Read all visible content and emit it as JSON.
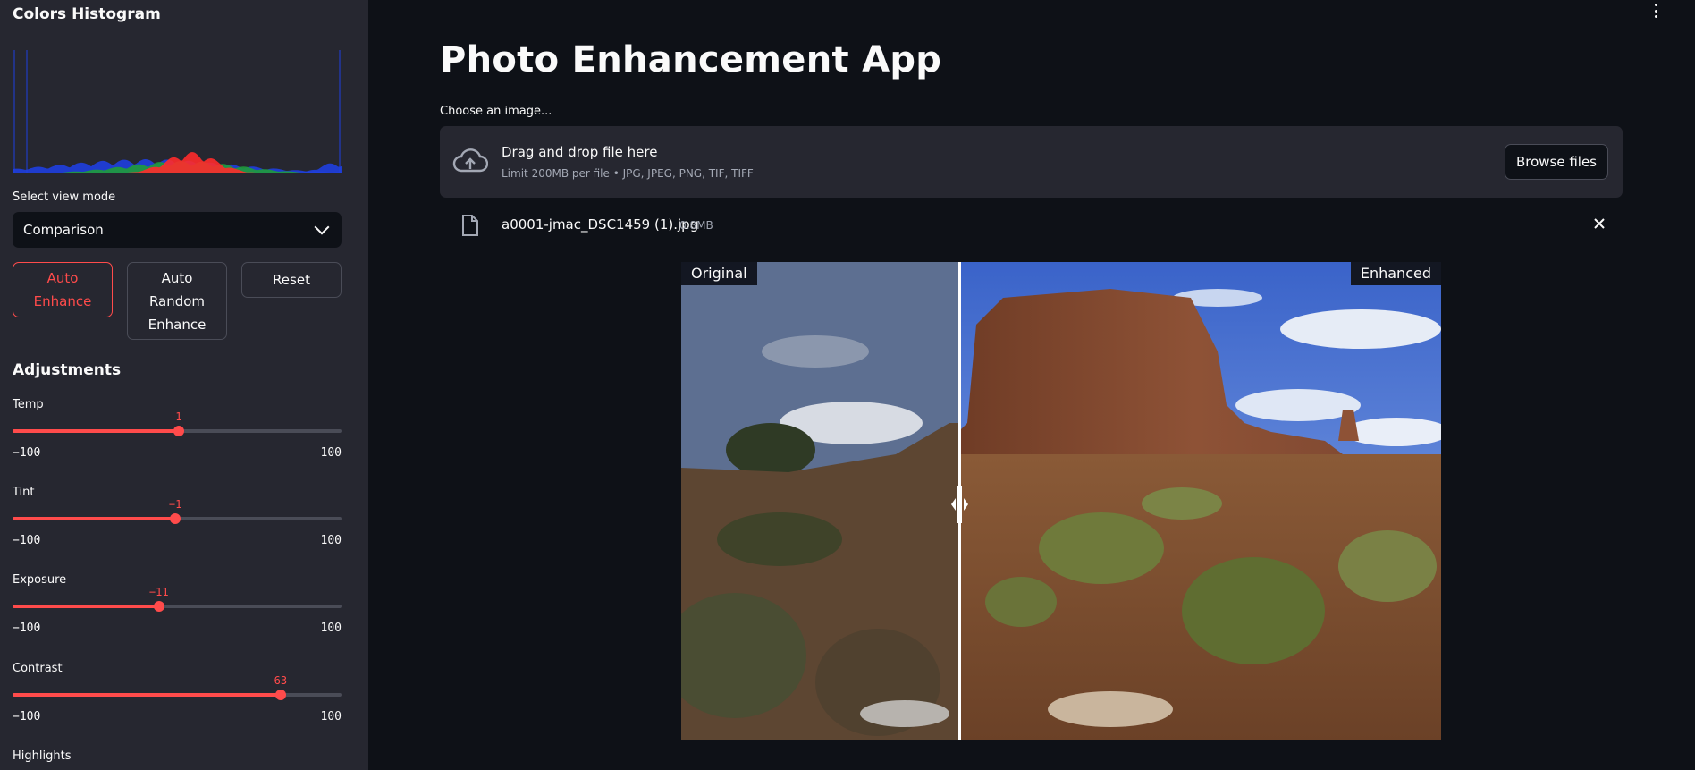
{
  "sidebar": {
    "histogram_title": "Colors Histogram",
    "view_mode_label": "Select view mode",
    "view_mode_value": "Comparison",
    "buttons": {
      "auto_enhance": "Auto Enhance",
      "auto_random_enhance": "Auto Random Enhance",
      "reset": "Reset"
    },
    "adjustments_title": "Adjustments",
    "sliders": [
      {
        "label": "Temp",
        "value": 1,
        "min": -100,
        "max": 100,
        "value_text": "1",
        "min_text": "−100",
        "max_text": "100"
      },
      {
        "label": "Tint",
        "value": -1,
        "min": -100,
        "max": 100,
        "value_text": "−1",
        "min_text": "−100",
        "max_text": "100"
      },
      {
        "label": "Exposure",
        "value": -11,
        "min": -100,
        "max": 100,
        "value_text": "−11",
        "min_text": "−100",
        "max_text": "100"
      },
      {
        "label": "Contrast",
        "value": 63,
        "min": -100,
        "max": 100,
        "value_text": "63",
        "min_text": "−100",
        "max_text": "100"
      },
      {
        "label": "Highlights"
      }
    ]
  },
  "main": {
    "title": "Photo Enhancement App",
    "uploader_label": "Choose an image...",
    "dropzone_title": "Drag and drop file here",
    "dropzone_limits": "Limit 200MB per file • JPG, JPEG, PNG, TIF, TIFF",
    "browse_button": "Browse files",
    "file_name": "a0001-jmac_DSC1459 (1).jpg",
    "file_size": "0.8MB",
    "compare_left_label": "Original",
    "compare_right_label": "Enhanced",
    "compare_split_fraction": 0.366
  },
  "colors": {
    "accent": "#ff4b4b",
    "background": "#0e1117",
    "sidebar": "#262730",
    "hist_red": "#ff2b2b",
    "hist_green": "#1f9c3a",
    "hist_blue": "#1f3fe0"
  },
  "icons": {
    "upload": "cloud-upload-icon",
    "file": "file-icon",
    "close": "close-icon",
    "menu": "vertical-dots-icon",
    "select": "chevron-down-icon",
    "handle": "split-handle-icon"
  }
}
